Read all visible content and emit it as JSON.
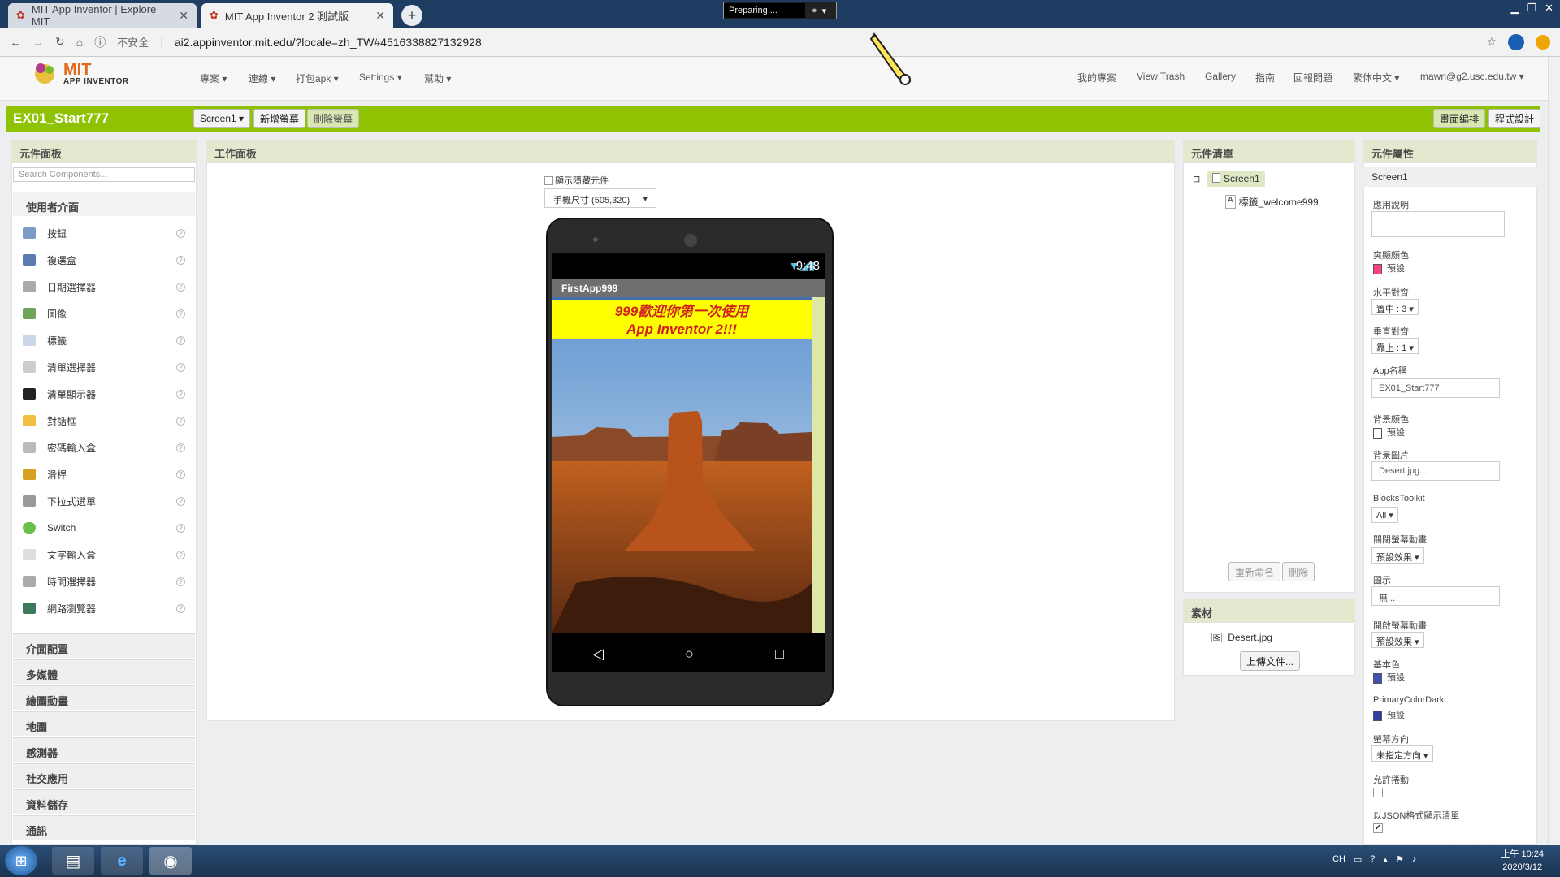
{
  "browser": {
    "tabs": [
      {
        "title": "MIT App Inventor | Explore MIT",
        "active": false
      },
      {
        "title": "MIT App Inventor 2 測試版",
        "active": true
      }
    ],
    "recording": "Preparing ...",
    "security": "不安全",
    "url": "ai2.appinventor.mit.edu/?locale=zh_TW#4516338827132928"
  },
  "app": {
    "logo_top": "MIT",
    "logo_bottom": "APP INVENTOR",
    "menu": [
      "專案 ▾",
      "連線 ▾",
      "打包apk ▾",
      "Settings ▾",
      "幫助 ▾"
    ],
    "right_menu": [
      "我的專案",
      "View Trash",
      "Gallery",
      "指南",
      "回報問題",
      "繁体中文 ▾",
      "mawn@g2.usc.edu.tw ▾"
    ]
  },
  "project": {
    "name": "EX01_Start777",
    "screen_select": "Screen1 ▾",
    "add_screen": "新增螢幕",
    "remove_screen": "刪除螢幕",
    "designer": "畫面編排",
    "blocks": "程式設計"
  },
  "palette": {
    "title": "元件面板",
    "search_placeholder": "Search Components...",
    "ui_category": "使用者介面",
    "items": [
      "按鈕",
      "複選盒",
      "日期選擇器",
      "圖像",
      "標籤",
      "清單選擇器",
      "清單顯示器",
      "對話框",
      "密碼輸入盒",
      "滑桿",
      "下拉式選單",
      "Switch",
      "文字輸入盒",
      "時間選擇器",
      "網路瀏覽器"
    ],
    "help": "?",
    "categories": [
      "介面配置",
      "多媒體",
      "繪圖動畫",
      "地圖",
      "感測器",
      "社交應用",
      "資料儲存",
      "通訊"
    ]
  },
  "viewer": {
    "title": "工作面板",
    "show_hidden": "顯示隱藏元件",
    "size_select": "手機尺寸 (505,320)",
    "time": "9:48",
    "app_title": "FirstApp999",
    "welcome_line1": "999歡迎你第一次使用",
    "welcome_line2": "App Inventor 2!!!",
    "nav": [
      "◁",
      "○",
      "□"
    ]
  },
  "components": {
    "title": "元件清單",
    "tree": [
      "Screen1",
      "標籤_welcome999"
    ],
    "collapse": "⊟",
    "rename": "重新命名",
    "delete": "刪除"
  },
  "media": {
    "title": "素材",
    "file": "Desert.jpg",
    "upload": "上傳文件..."
  },
  "properties": {
    "title": "元件屬性",
    "target": "Screen1",
    "labels": {
      "about": "應用說明",
      "accent": "突顯顏色",
      "halign": "水平對齊",
      "valign": "垂直對齊",
      "appname": "App名稱",
      "bgcolor": "背景顏色",
      "bgimage": "背景圖片",
      "blocks": "BlocksToolkit",
      "close_anim": "關閉螢幕動畫",
      "icon": "圖示",
      "open_anim": "開啟螢幕動畫",
      "primary": "基本色",
      "primary_dark": "PrimaryColorDark",
      "orientation": "螢幕方向",
      "scroll": "允許捲動",
      "json": "以JSON格式顯示清單"
    },
    "values": {
      "accent": "預設",
      "halign": "置中 : 3 ▾",
      "valign": "靠上 : 1 ▾",
      "appname": "EX01_Start777",
      "bgcolor": "預設",
      "bgimage": "Desert.jpg...",
      "blocks": "All ▾",
      "close_anim": "預設效果 ▾",
      "icon": "無...",
      "open_anim": "預設效果 ▾",
      "primary": "預設",
      "primary_dark": "預設",
      "orientation": "未指定方向 ▾",
      "json_check": "✔"
    },
    "colors": {
      "accent": "#ff4081",
      "bg": "#ffffff",
      "primary": "#3f51b5",
      "primary_dark": "#303f9f"
    }
  },
  "taskbar": {
    "ime": "CH",
    "time": "上午 10:24",
    "date": "2020/3/12"
  }
}
